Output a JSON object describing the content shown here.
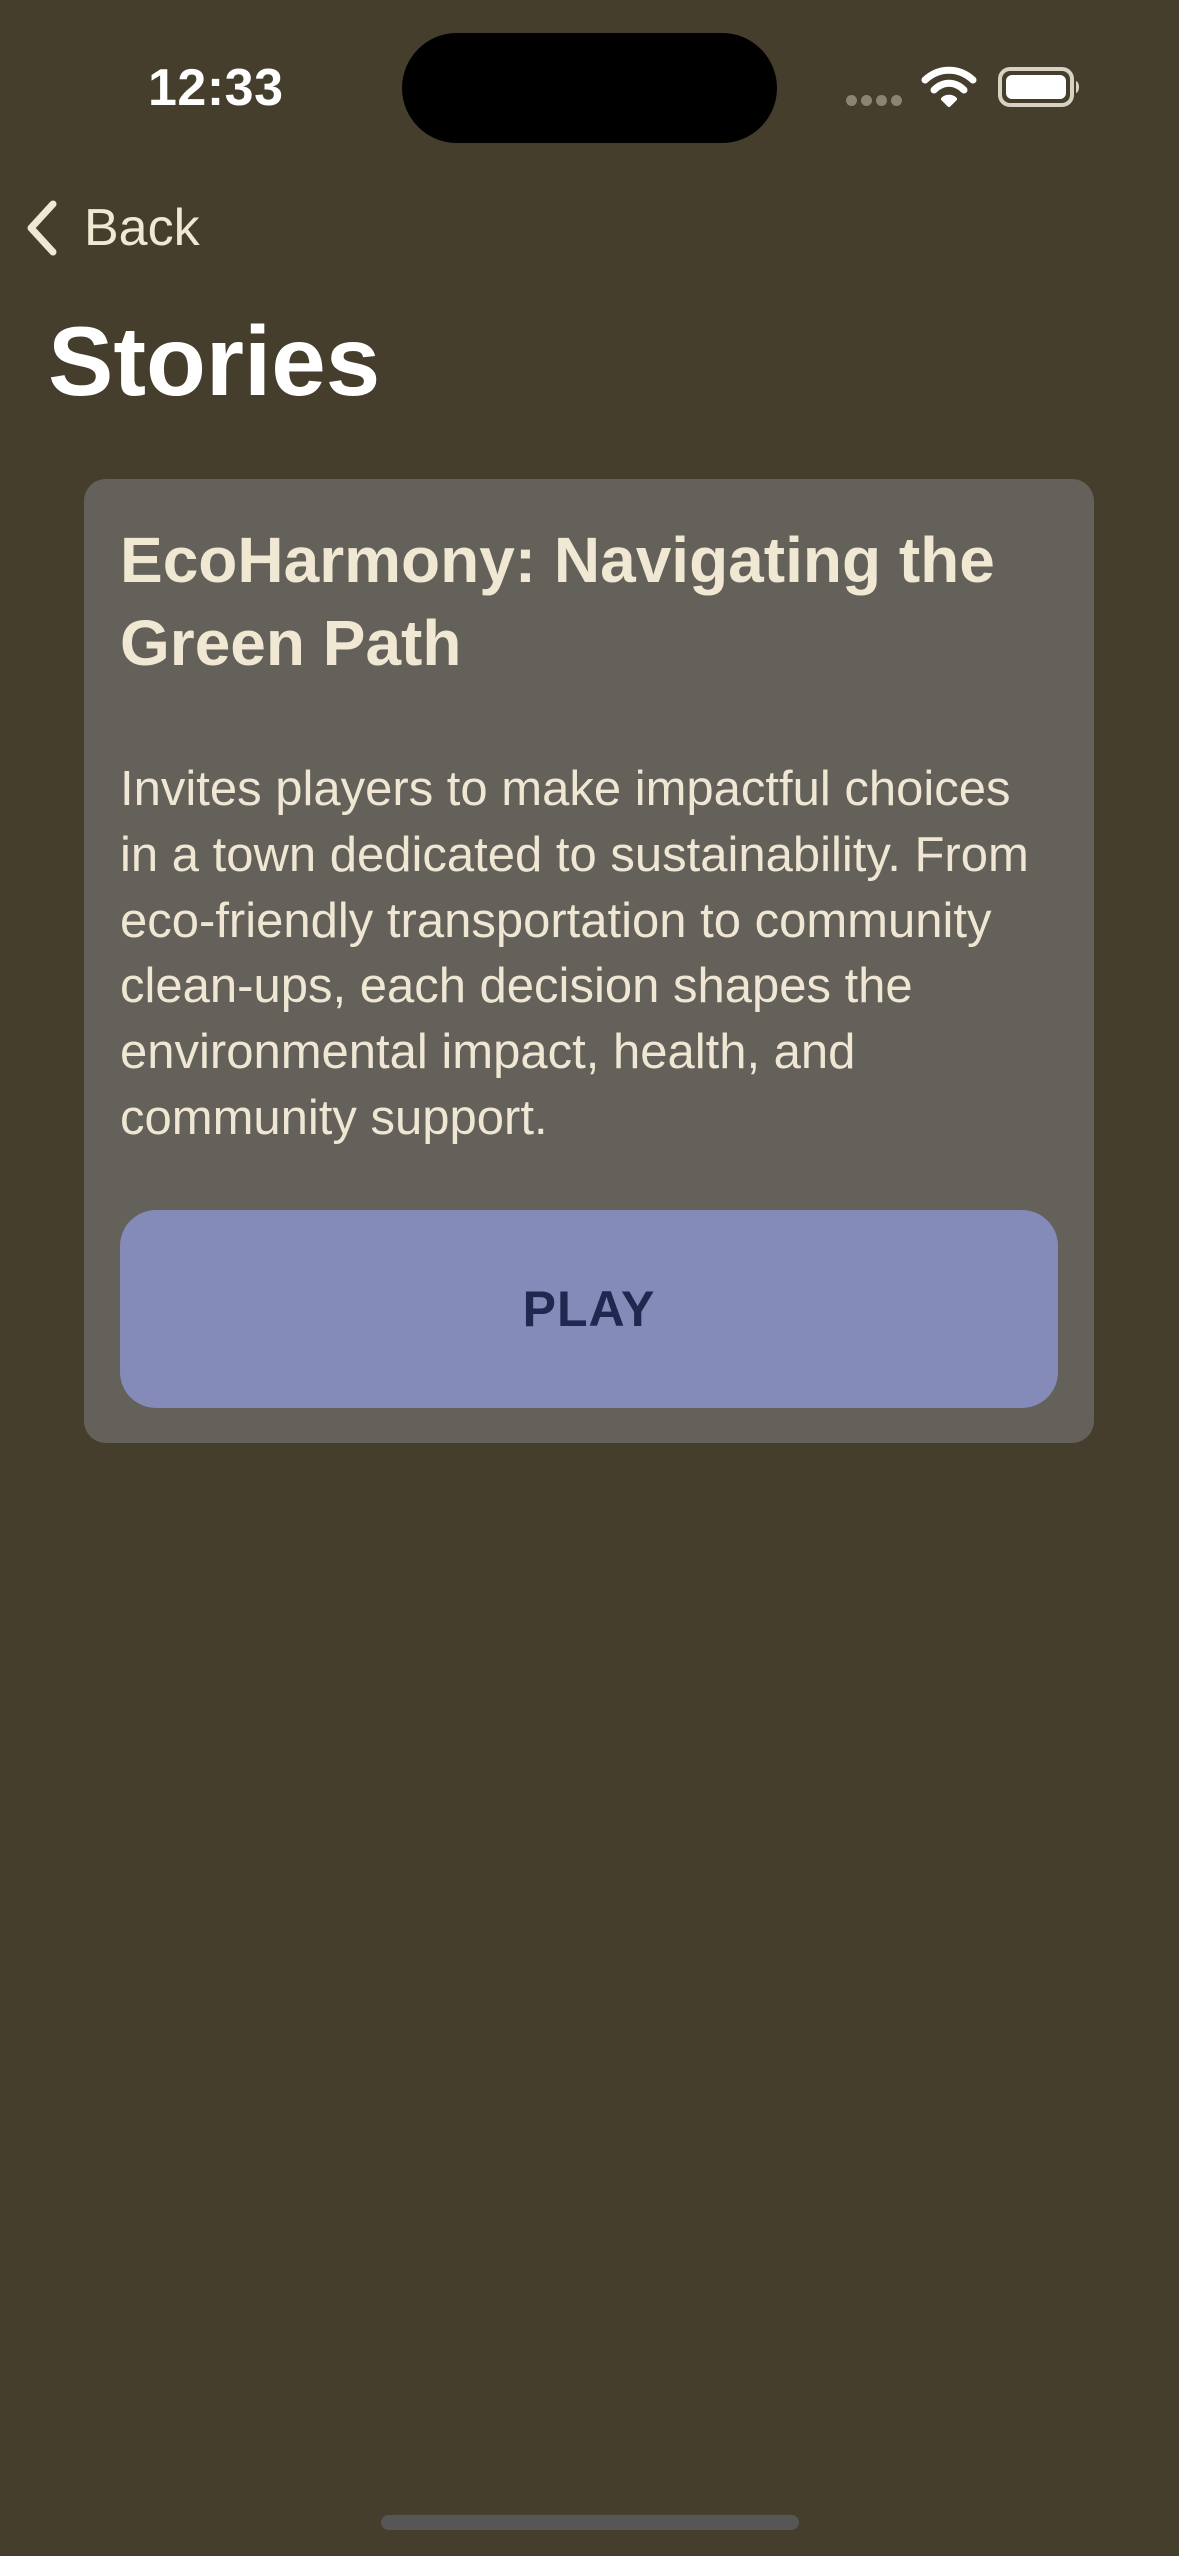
{
  "status_bar": {
    "time": "12:33",
    "icons": [
      "signal-dots-icon",
      "wifi-icon",
      "battery-icon"
    ],
    "colors": {
      "time": "#ffffff",
      "signal_dots": "#8b8473",
      "battery": "#ffffff"
    }
  },
  "navigation": {
    "back_icon": "chevron-left-icon",
    "back_label": "Back"
  },
  "page": {
    "title": "Stories"
  },
  "story": {
    "title": "EcoHarmony: Navigating the Green Path",
    "description": "Invites players to make impactful choices in a town dedicated to sustainability. From eco-friendly transportation to community clean-ups, each decision shapes the environmental impact, health, and community support.",
    "play_label": "PLAY"
  },
  "colors": {
    "background": "#463e2c",
    "card_background": "#63615a",
    "primary_text": "#f1e8d4",
    "play_button": "#848bb9",
    "play_label": "#20284f"
  }
}
